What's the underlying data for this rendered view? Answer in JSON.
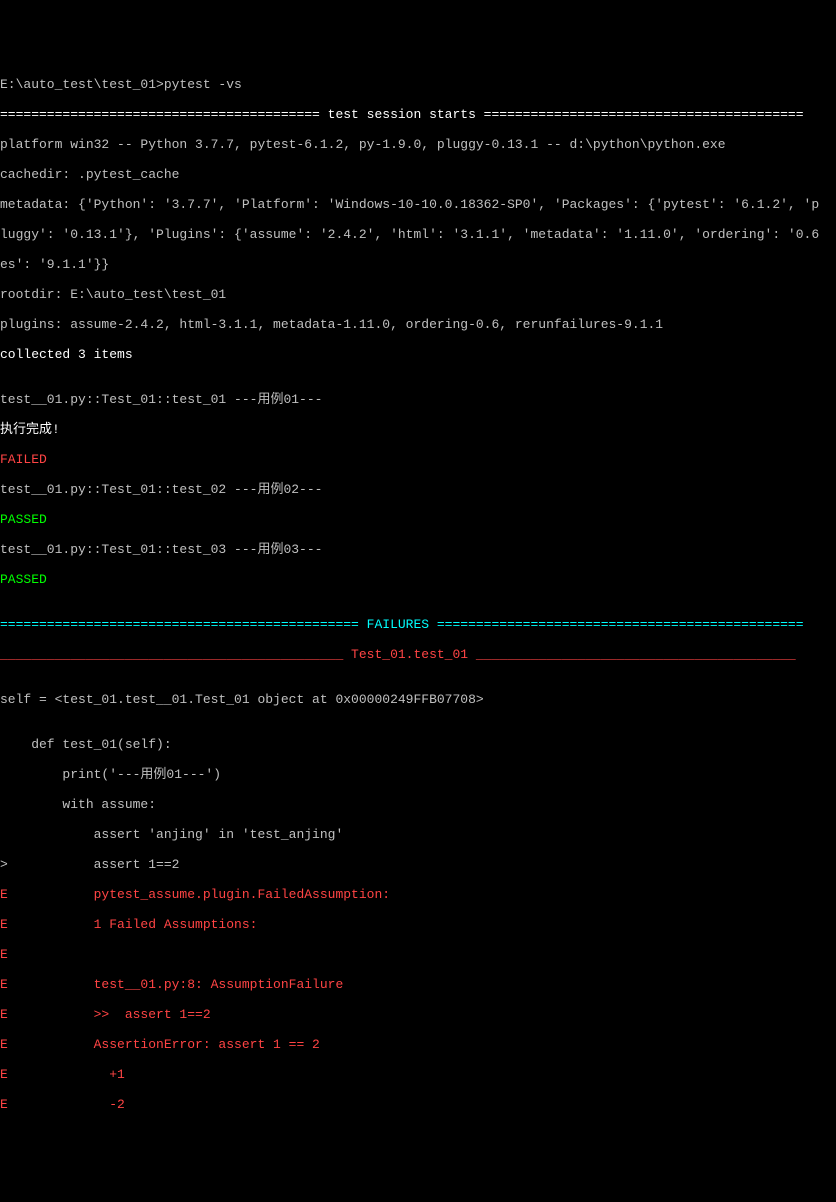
{
  "prompt": "E:\\auto_test\\test_01>pytest -vs",
  "session_header": "========================================= test session starts =========================================",
  "platform_line": "platform win32 -- Python 3.7.7, pytest-6.1.2, py-1.9.0, pluggy-0.13.1 -- d:\\python\\python.exe",
  "cachedir_line": "cachedir: .pytest_cache",
  "metadata1": "metadata: {'Python': '3.7.7', 'Platform': 'Windows-10-10.0.18362-SP0', 'Packages': {'pytest': '6.1.2', 'p",
  "metadata2": "luggy': '0.13.1'}, 'Plugins': {'assume': '2.4.2', 'html': '3.1.1', 'metadata': '1.11.0', 'ordering': '0.6",
  "metadata3": "es': '9.1.1'}}",
  "rootdir_line": "rootdir: E:\\auto_test\\test_01",
  "plugins_line": "plugins: assume-2.4.2, html-3.1.1, metadata-1.11.0, ordering-0.6, rerunfailures-9.1.1",
  "collected_line": "collected 3 items",
  "blank": "",
  "t1_line": "test__01.py::Test_01::test_01 ---用例01---",
  "exec_done": "执行完成!",
  "failed": "FAILED",
  "t2_line": "test__01.py::Test_01::test_02 ---用例02---",
  "passed": "PASSED",
  "t3_line": "test__01.py::Test_01::test_03 ---用例03---",
  "failures_header": "============================================== FAILURES ===============================================",
  "failure_title": "____________________________________________ Test_01.test_01 _________________________________________",
  "self_line": "self = <test_01.test__01.Test_01 object at 0x00000249FFB07708>",
  "code1": "    def test_01(self):",
  "code2": "        print('---用例01---')",
  "code3": "        with assume:",
  "code4": "            assert 'anjing' in 'test_anjing'",
  "code5": ">           assert 1==2",
  "err1": "E           pytest_assume.plugin.FailedAssumption:",
  "err2": "E           1 Failed Assumptions:",
  "err3": "E",
  "err4": "E           test__01.py:8: AssumptionFailure",
  "err5": "E           >>  assert 1==2",
  "err6": "E           AssertionError: assert 1 == 2",
  "err7": "E             +1",
  "err8": "E             -2"
}
